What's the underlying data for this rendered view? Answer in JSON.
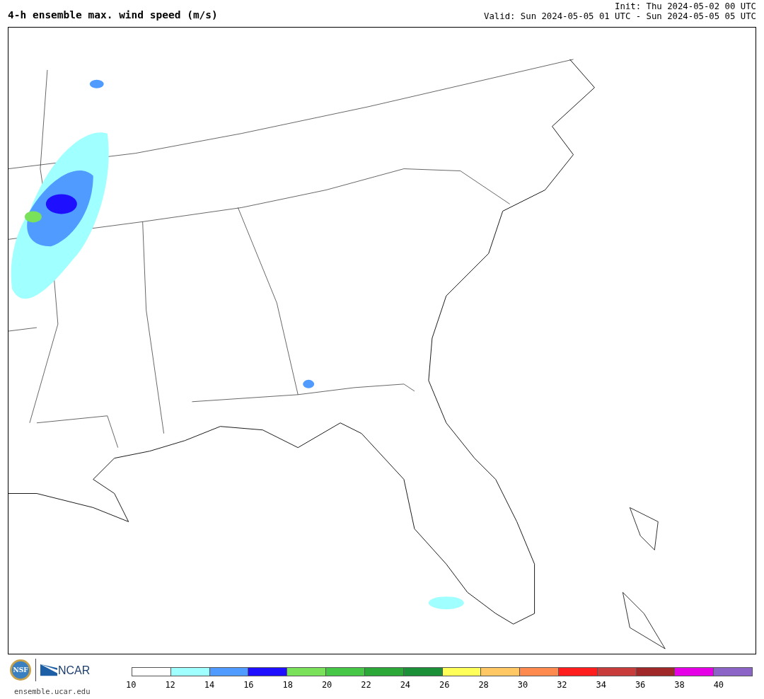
{
  "title": "4-h ensemble max. wind speed (m/s)",
  "init": "Init: Thu 2024-05-02 00 UTC",
  "valid": "Valid: Sun 2024-05-05 01 UTC - Sun 2024-05-05 05 UTC",
  "logos": [
    {
      "kind": "nsf",
      "label": "NSF"
    },
    {
      "kind": "ncar",
      "label": "NCAR"
    }
  ],
  "url": "ensemble.ucar.edu",
  "colorbar": {
    "swatches": [
      {
        "color": "#ffffff",
        "label": "10"
      },
      {
        "color": "#a0ffff",
        "label": "12"
      },
      {
        "color": "#4f9bff",
        "label": "14"
      },
      {
        "color": "#1e0fff",
        "label": "16"
      },
      {
        "color": "#7ae25a",
        "label": "18"
      },
      {
        "color": "#46c746",
        "label": "20"
      },
      {
        "color": "#2ca838",
        "label": "22"
      },
      {
        "color": "#1c9038",
        "label": "24"
      },
      {
        "color": "#ffff5a",
        "label": "26"
      },
      {
        "color": "#ffc864",
        "label": "28"
      },
      {
        "color": "#ff8a50",
        "label": "30"
      },
      {
        "color": "#ff1e1e",
        "label": "32"
      },
      {
        "color": "#c83c3c",
        "label": "34"
      },
      {
        "color": "#a02828",
        "label": "36"
      },
      {
        "color": "#e600e6",
        "label": "38"
      },
      {
        "color": "#8c64c8",
        "label": "40"
      }
    ]
  }
}
